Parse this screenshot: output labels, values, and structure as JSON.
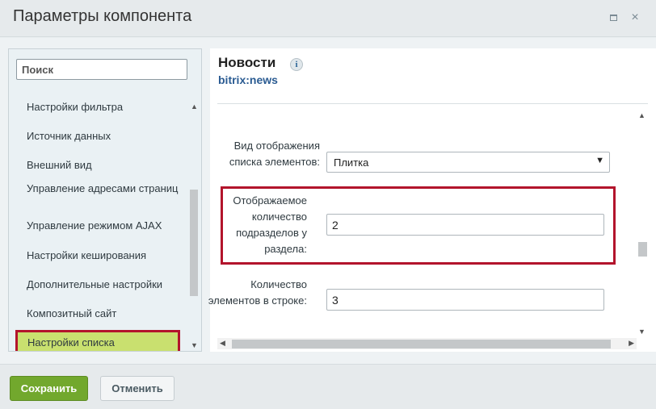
{
  "window": {
    "title": "Параметры компонента",
    "maximize_icon": "maximize-icon",
    "close_icon": "close-icon",
    "close_glyph": "×"
  },
  "sidebar": {
    "search_placeholder": "Поиск",
    "items": [
      {
        "label": "Настройки фильтра"
      },
      {
        "label": "Источник данных"
      },
      {
        "label": "Внешний вид"
      },
      {
        "label": "Управление адресами страниц"
      },
      {
        "label": "Управление режимом AJAX"
      },
      {
        "label": "Настройки кеширования"
      },
      {
        "label": "Дополнительные настройки"
      },
      {
        "label": "Композитный сайт"
      },
      {
        "label": "Настройки списка",
        "selected": true
      }
    ]
  },
  "component": {
    "title": "Новости",
    "code": "bitrix:news",
    "info_icon": "info-icon",
    "info_glyph": "i"
  },
  "fields": {
    "display_mode": {
      "label": "Вид отображения списка элементов:",
      "value": "Плитка"
    },
    "subsections_count": {
      "label": "Отображаемое количество подразделов у раздела:",
      "value": "2"
    },
    "elements_in_row": {
      "label": "Количество элементов в строке:",
      "value": "3"
    }
  },
  "footer": {
    "save_label": "Сохранить",
    "cancel_label": "Отменить"
  },
  "colors": {
    "accent_green": "#72a82d",
    "highlight_red": "#b3142c",
    "selected_bg": "#c9e06f",
    "link_blue": "#2a5b92"
  }
}
